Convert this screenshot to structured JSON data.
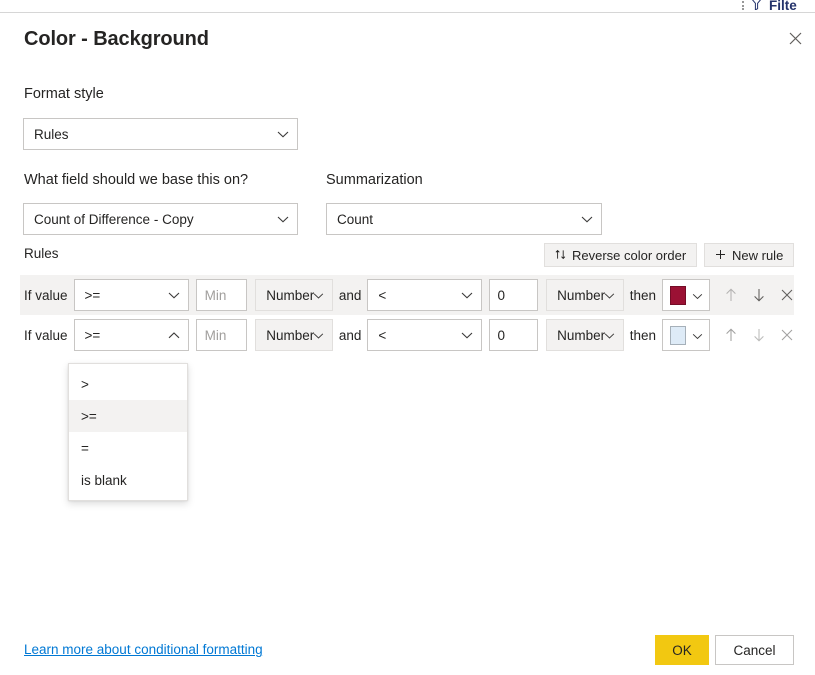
{
  "background_app": {
    "filters_pane_label": "Filte",
    "filter_icon": "funnel-icon",
    "more_options_icon": "kebab-menu-icon"
  },
  "dialog": {
    "title": "Color - Background",
    "close_icon": "close-icon",
    "format_style": {
      "label": "Format style",
      "value": "Rules",
      "chevron_icon": "chevron-down-icon"
    },
    "base_field": {
      "label": "What field should we base this on?",
      "value": "Count of Difference - Copy",
      "chevron_icon": "chevron-down-icon"
    },
    "summarization": {
      "label": "Summarization",
      "value": "Count",
      "chevron_icon": "chevron-down-icon"
    },
    "rules": {
      "label": "Rules",
      "reverse_button": {
        "label": "Reverse color order",
        "icon": "sort-order-icon"
      },
      "new_rule_button": {
        "label": "New rule",
        "icon": "plus-icon"
      },
      "if_value_label": "If value",
      "and_label": "and",
      "then_label": "then",
      "rows": [
        {
          "operator": ">=",
          "operator_chevron": "chevron-down-icon",
          "value": "",
          "value_placeholder": "Min",
          "value_type": "Number",
          "operator2": "<",
          "operator2_chevron": "chevron-down-icon",
          "value2": "0",
          "value2_type": "Number",
          "color": "#9B1134",
          "color_chevron": "chevron-down-icon",
          "move_up_icon": "arrow-up-icon",
          "move_down_icon": "arrow-down-icon",
          "delete_icon": "close-icon"
        },
        {
          "operator": ">=",
          "operator_chevron": "chevron-up-icon",
          "value": "",
          "value_placeholder": "Min",
          "value_type": "Number",
          "operator2": "<",
          "operator2_chevron": "chevron-down-icon",
          "value2": "0",
          "value2_type": "Number",
          "color": "#DEEBF7",
          "color_chevron": "chevron-down-icon",
          "move_up_icon": "arrow-up-icon",
          "move_down_icon": "arrow-down-icon",
          "delete_icon": "close-icon"
        }
      ]
    },
    "operator_menu": {
      "open": true,
      "selected": ">=",
      "options": [
        {
          "label": ">"
        },
        {
          "label": ">="
        },
        {
          "label": "="
        },
        {
          "label": "is blank"
        }
      ]
    },
    "footer": {
      "learn_more_link": "Learn more about conditional formatting",
      "ok_label": "OK",
      "cancel_label": "Cancel"
    }
  },
  "colors": {
    "accent_yellow": "#F2C811",
    "link_blue": "#0078D4",
    "rule1_swatch": "#9B1134",
    "rule2_swatch": "#DEEBF7"
  }
}
